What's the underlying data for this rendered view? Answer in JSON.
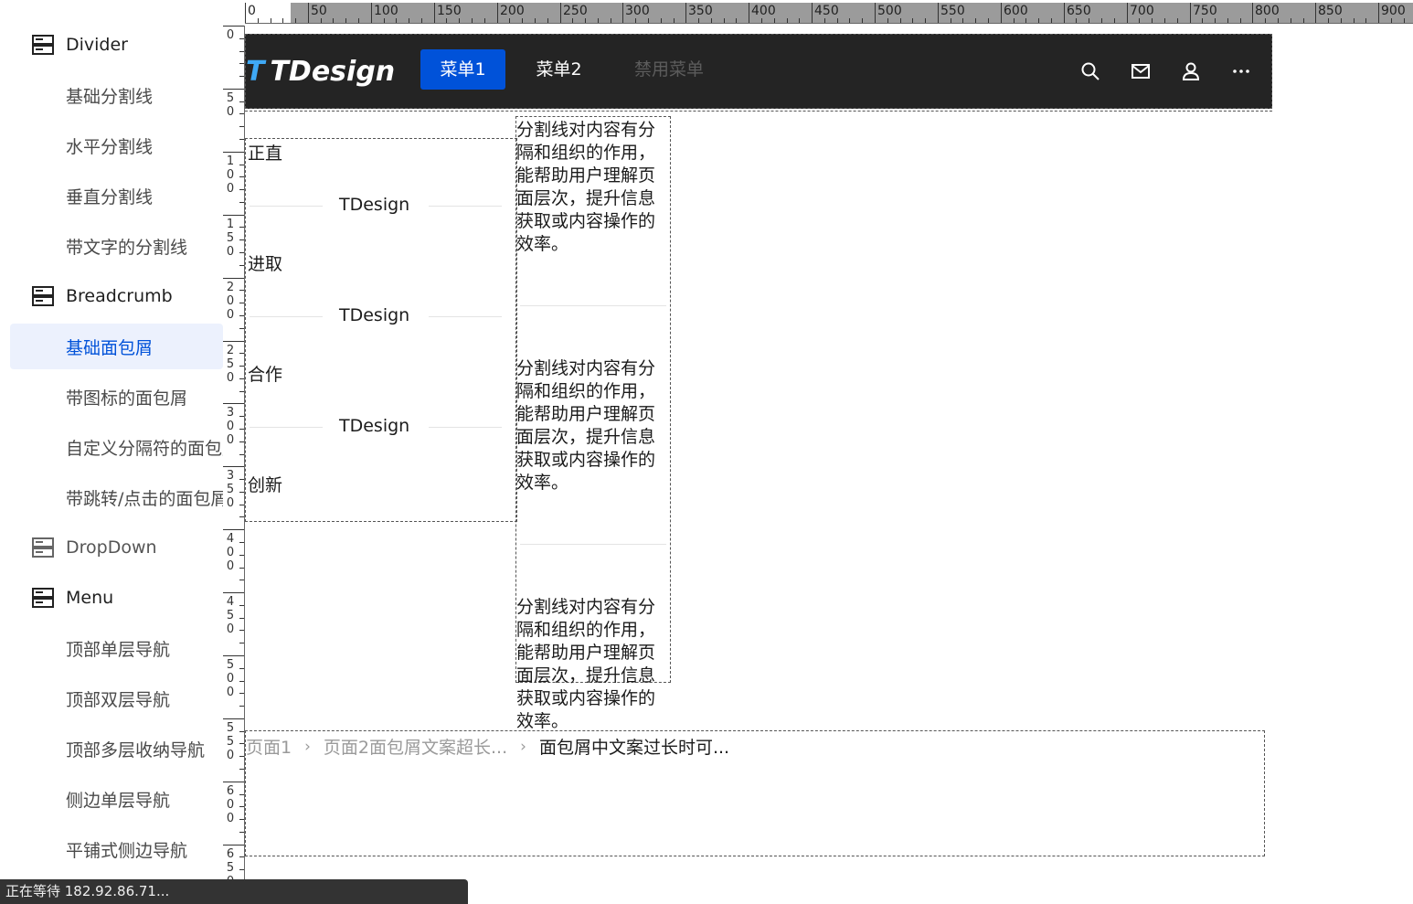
{
  "sidebar": {
    "groups": [
      {
        "label": "Divider",
        "items": [
          "基础分割线",
          "水平分割线",
          "垂直分割线",
          "带文字的分割线"
        ]
      },
      {
        "label": "Breadcrumb",
        "items": [
          "基础面包屑",
          "带图标的面包屑",
          "自定义分隔符的面包屑",
          "带跳转/点击的面包屑"
        ]
      },
      {
        "label": "DropDown",
        "items": []
      },
      {
        "label": "Menu",
        "items": [
          "顶部单层导航",
          "顶部双层导航",
          "顶部多层收纳导航",
          "侧边单层导航",
          "平铺式侧边导航"
        ]
      }
    ],
    "active_item": "基础面包屑"
  },
  "ruler": {
    "top_labels": [
      "0",
      "50",
      "100",
      "150",
      "200",
      "250",
      "300",
      "350",
      "400",
      "450",
      "500",
      "550",
      "600",
      "650",
      "700",
      "750",
      "800",
      "850",
      "900"
    ],
    "left_labels": [
      "0",
      "50",
      "100",
      "150",
      "200",
      "250",
      "300",
      "350",
      "400",
      "450",
      "500",
      "550",
      "600",
      "650"
    ]
  },
  "topbar": {
    "logo_mark": "T",
    "logo_text": "TDesign",
    "menu": [
      {
        "label": "菜单1",
        "state": "active"
      },
      {
        "label": "菜单2",
        "state": "normal"
      },
      {
        "label": "禁用菜单",
        "state": "disabled"
      }
    ],
    "icons": [
      "search-icon",
      "mail-icon",
      "user-icon",
      "more-icon"
    ]
  },
  "divider_demo": {
    "words": [
      "正直",
      "进取",
      "合作",
      "创新"
    ],
    "divider_text": "TDesign"
  },
  "vertical_demo": {
    "paragraph": "分割线对内容有分隔和组织的作用，能帮助用户理解页面层次，提升信息获取或内容操作的效率。",
    "lines": [
      "分割线对内容有分",
      "隔和组织的作用，",
      "能帮助用户理解页",
      "面层次，提升信息",
      "获取或内容操作的",
      "效率。"
    ]
  },
  "breadcrumb": {
    "items": [
      "页面1",
      "页面2面包屑文案超长...",
      "面包屑中文案过长时可..."
    ],
    "separator": "›"
  },
  "status_bar": {
    "text": "正在等待 182.92.86.71..."
  },
  "colors": {
    "brand": "#0052d9",
    "topbar_bg": "#242424",
    "active_bg": "#ecf1fd"
  }
}
